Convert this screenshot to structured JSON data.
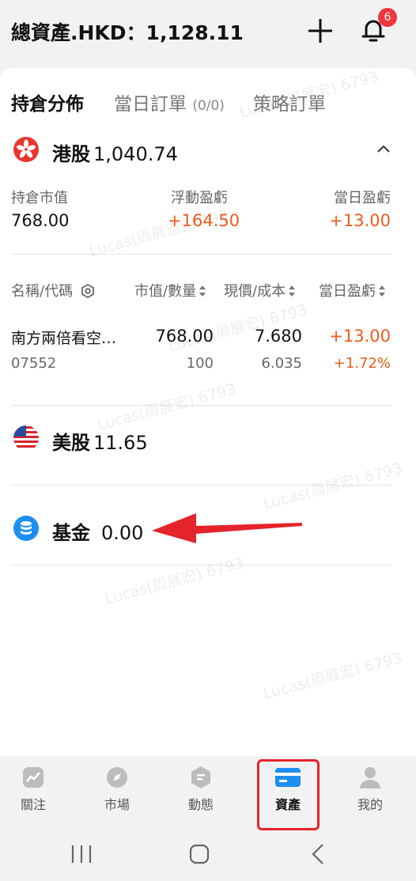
{
  "header": {
    "total_assets": "總資產.HKD：1,128.11",
    "notification_count": "6"
  },
  "tabs": [
    {
      "label": "持倉分佈",
      "count": ""
    },
    {
      "label": "當日訂單",
      "count": "(0/0)"
    },
    {
      "label": "策略訂單",
      "count": ""
    }
  ],
  "hk": {
    "title": "港股",
    "value": "1,040.74",
    "market_value_label": "持倉市值",
    "market_value": "768.00",
    "floating_pl_label": "浮動盈虧",
    "floating_pl": "+164.50",
    "daily_pl_label": "當日盈虧",
    "daily_pl": "+13.00"
  },
  "columns": {
    "name_code": "名稱/代碼",
    "mv_qty": "市值/數量",
    "price_cost": "現價/成本",
    "daily_pl": "當日盈虧"
  },
  "positions": [
    {
      "name": "南方兩倍看空…",
      "code": "07552",
      "market_value": "768.00",
      "quantity": "100",
      "price": "7.680",
      "cost": "6.035",
      "daily_pl": "+13.00",
      "daily_pl_pct": "+1.72%"
    }
  ],
  "us": {
    "title": "美股",
    "value": "11.65"
  },
  "fund": {
    "title": "基金",
    "value": "0.00"
  },
  "tabbar": [
    {
      "label": "關注",
      "icon": "chart-icon"
    },
    {
      "label": "市場",
      "icon": "compass-icon"
    },
    {
      "label": "動態",
      "icon": "hexagon-icon"
    },
    {
      "label": "資產",
      "icon": "wallet-icon"
    },
    {
      "label": "我的",
      "icon": "person-icon"
    }
  ],
  "watermark": "Lucas(周展宏) 6793",
  "colors": {
    "positive": "#ee5b1c",
    "accent": "#1d8ff0",
    "annotation": "#e5232a",
    "badge": "#f2353c"
  }
}
